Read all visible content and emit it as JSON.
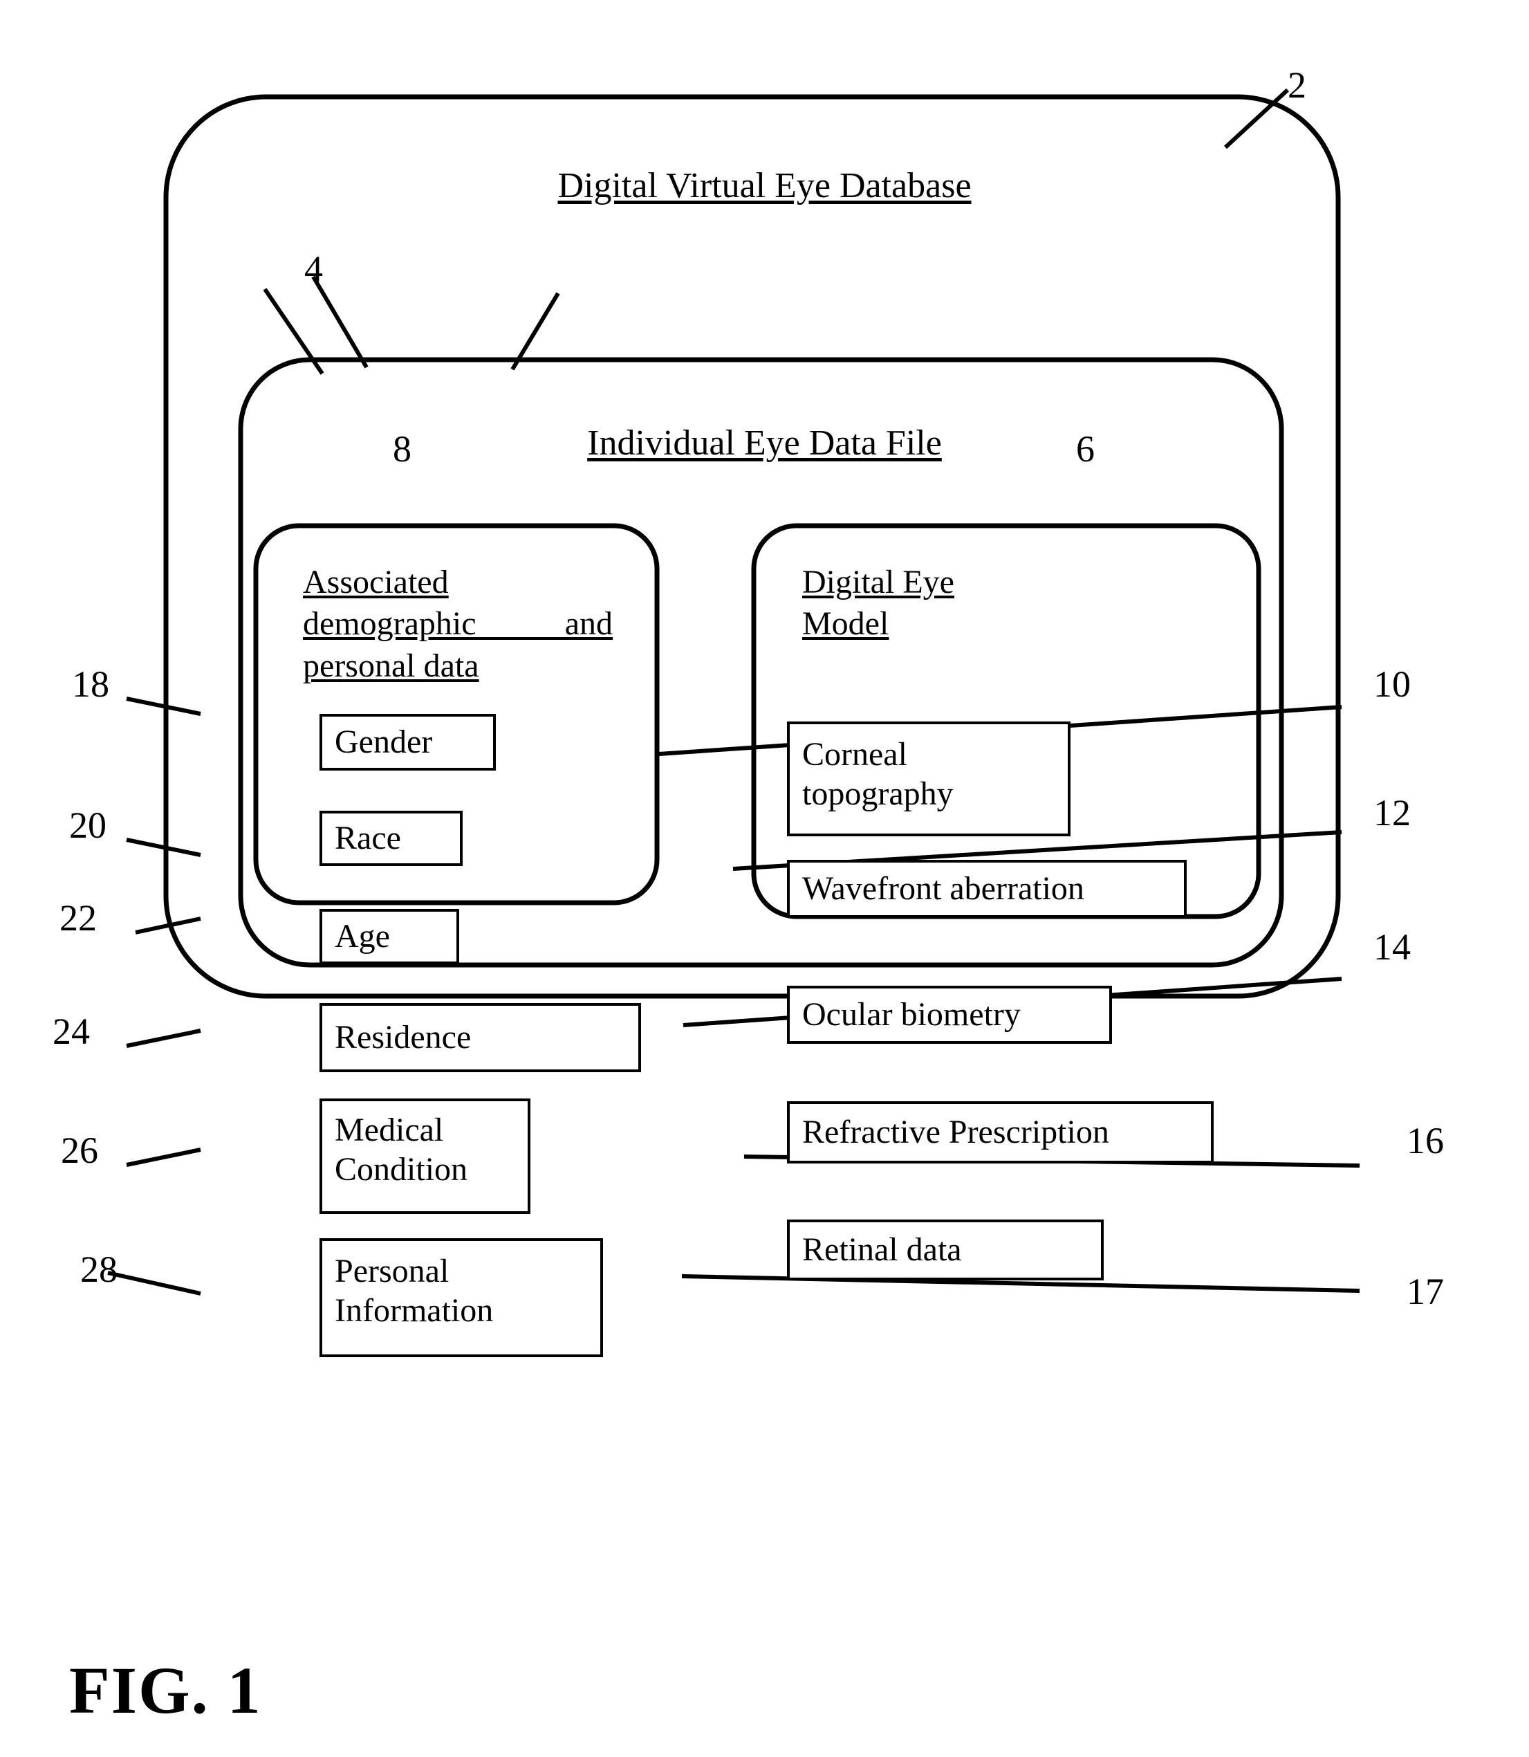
{
  "figure": {
    "caption": "FIG. 1",
    "outer_container": {
      "ref": "2",
      "title": "Digital Virtual Eye Database"
    },
    "middle_container": {
      "ref": "4",
      "title": "Individual Eye Data File"
    },
    "left_panel": {
      "ref": "8",
      "title_lines": [
        "Associated",
        "demographic  and",
        "personal data"
      ],
      "title_text": "Associated demographic and personal data",
      "items": [
        {
          "ref": "18",
          "label": "Gender"
        },
        {
          "ref": "20",
          "label": "Race"
        },
        {
          "ref": "22",
          "label": "Age"
        },
        {
          "ref": "24",
          "label": "Residence"
        },
        {
          "ref": "26",
          "label": "Medical Condition",
          "line1": "Medical",
          "line2": "Condition"
        },
        {
          "ref": "28",
          "label": "Personal Information",
          "line1": "Personal",
          "line2": "Information"
        }
      ]
    },
    "right_panel": {
      "ref": "6",
      "title_lines": [
        "Digital Eye",
        "Model"
      ],
      "title_text": "Digital Eye Model",
      "items": [
        {
          "ref": "10",
          "label": "Corneal topography",
          "line1": "Corneal",
          "line2": "topography"
        },
        {
          "ref": "12",
          "label": "Wavefront aberration"
        },
        {
          "ref": "14",
          "label": "Ocular biometry"
        },
        {
          "ref": "16",
          "label": "Refractive Prescription"
        },
        {
          "ref": "17",
          "label": "Retinal data"
        }
      ]
    },
    "colors": {
      "ink": "#000000",
      "background": "#ffffff"
    }
  }
}
